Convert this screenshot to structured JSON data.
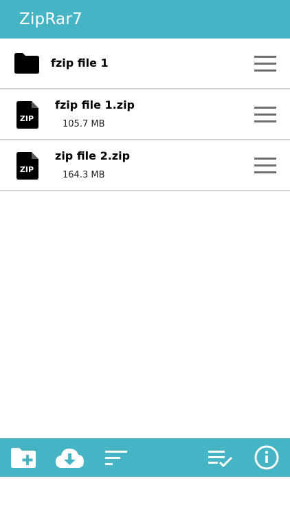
{
  "app": {
    "title": "ZipRar7",
    "accent_color": "#45b4c4"
  },
  "files": [
    {
      "name": "fzip file 1",
      "type": "folder",
      "icon": "folder-icon"
    },
    {
      "name": "fzip file 1.zip",
      "size": "105.7 MB",
      "type": "zip",
      "icon": "zip-file-icon",
      "badge": "ZIP"
    },
    {
      "name": "zip file 2.zip",
      "size": "164.3 MB",
      "type": "zip",
      "icon": "zip-file-icon",
      "badge": "ZIP"
    }
  ],
  "toolbar": {
    "buttons": [
      {
        "name": "new-folder",
        "icon": "folder-plus-icon"
      },
      {
        "name": "download",
        "icon": "cloud-download-icon"
      },
      {
        "name": "sort",
        "icon": "sort-icon"
      },
      {
        "name": "select",
        "icon": "checklist-icon"
      },
      {
        "name": "info",
        "icon": "info-icon"
      }
    ]
  }
}
